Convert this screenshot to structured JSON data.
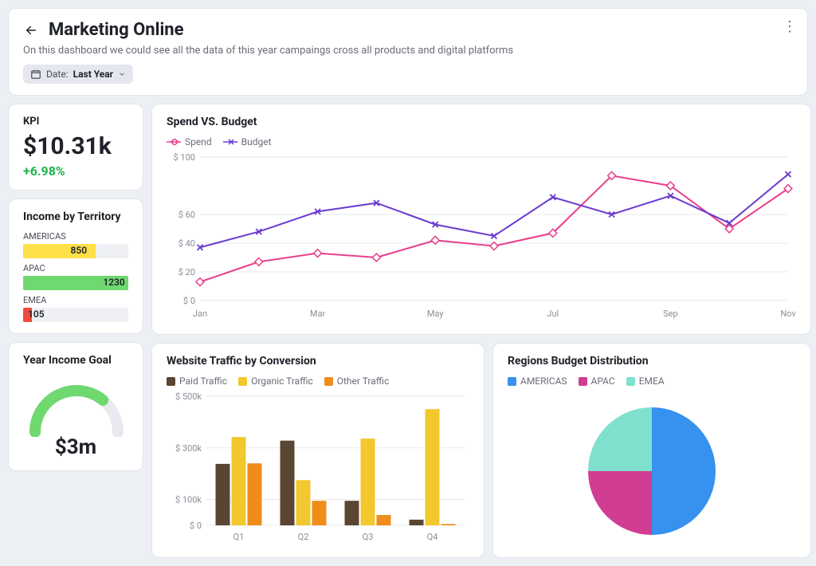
{
  "header": {
    "title": "Marketing Online",
    "subtitle": "On this dashboard we could see all the data of this year campaings cross all products and digital platforms",
    "date_chip_prefix": "Date: ",
    "date_chip_value": "Last Year"
  },
  "kpi": {
    "heading": "KPI",
    "value": "$10.31k",
    "delta": "+6.98%"
  },
  "territory": {
    "title": "Income by Territory",
    "items": [
      {
        "label": "AMERICAS",
        "value": 850,
        "color": "#fde04a"
      },
      {
        "label": "APAC",
        "value": 1230,
        "color": "#6fd86f"
      },
      {
        "label": "EMEA",
        "value": 105,
        "color": "#f24a3d"
      }
    ],
    "max": 1230
  },
  "goal": {
    "title": "Year Income Goal",
    "value": "$3m",
    "pct": 72
  },
  "spend": {
    "title": "Spend VS. Budget",
    "legend": {
      "a": "Spend",
      "b": "Budget"
    }
  },
  "traffic": {
    "title": "Website Traffic by Conversion",
    "legend": {
      "a": "Paid Traffic",
      "b": "Organic Traffic",
      "c": "Other Traffic"
    }
  },
  "pie": {
    "title": "Regions Budget Distribution",
    "legend": {
      "a": "AMERICAS",
      "b": "APAC",
      "c": "EMEA"
    }
  },
  "chart_data": [
    {
      "id": "spend_vs_budget",
      "type": "line",
      "title": "Spend VS. Budget",
      "xlabel": "",
      "ylabel": "",
      "ylim": [
        0,
        100
      ],
      "x": [
        "Jan",
        "Feb",
        "Mar",
        "Apr",
        "May",
        "Jun",
        "Jul",
        "Aug",
        "Sep",
        "Oct",
        "Nov"
      ],
      "x_ticks_shown": [
        "Jan",
        "Mar",
        "May",
        "Jul",
        "Sep",
        "Nov"
      ],
      "y_ticks": [
        0,
        20,
        40,
        60,
        100
      ],
      "series": [
        {
          "name": "Spend",
          "color": "#e83e8c",
          "marker": "diamond",
          "values": [
            13,
            27,
            33,
            30,
            42,
            38,
            47,
            87,
            80,
            50,
            78
          ]
        },
        {
          "name": "Budget",
          "color": "#6a3bcf",
          "marker": "x",
          "values": [
            37,
            48,
            62,
            68,
            53,
            45,
            72,
            60,
            73,
            54,
            88
          ]
        }
      ]
    },
    {
      "id": "website_traffic",
      "type": "bar",
      "title": "Website Traffic by Conversion",
      "xlabel": "",
      "ylabel": "",
      "ylim": [
        0,
        500
      ],
      "unit": "k",
      "categories": [
        "Q1",
        "Q2",
        "Q3",
        "Q4"
      ],
      "y_ticks": [
        0,
        100,
        300,
        500
      ],
      "series": [
        {
          "name": "Paid Traffic",
          "color": "#5a4533",
          "values": [
            238,
            328,
            95,
            22
          ]
        },
        {
          "name": "Organic Traffic",
          "color": "#f3c82e",
          "values": [
            342,
            175,
            336,
            450
          ]
        },
        {
          "name": "Other Traffic",
          "color": "#ef8c1a",
          "values": [
            240,
            95,
            40,
            5
          ]
        }
      ]
    },
    {
      "id": "regions_pie",
      "type": "pie",
      "title": "Regions Budget Distribution",
      "slices": [
        {
          "name": "AMERICAS",
          "color": "#3691ef",
          "value": 50
        },
        {
          "name": "APAC",
          "color": "#d13d92",
          "value": 25
        },
        {
          "name": "EMEA",
          "color": "#7fe0cd",
          "value": 25
        }
      ]
    },
    {
      "id": "income_by_territory",
      "type": "bar",
      "title": "Income by Territory",
      "orientation": "horizontal",
      "categories": [
        "AMERICAS",
        "APAC",
        "EMEA"
      ],
      "values": [
        850,
        1230,
        105
      ],
      "colors": [
        "#fde04a",
        "#6fd86f",
        "#f24a3d"
      ]
    },
    {
      "id": "year_income_goal",
      "type": "gauge",
      "title": "Year Income Goal",
      "value_label": "$3m",
      "pct": 72
    }
  ]
}
